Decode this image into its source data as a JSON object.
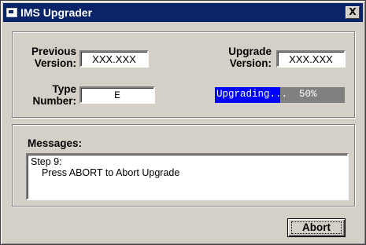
{
  "window": {
    "title": "IMS Upgrader",
    "close_label": "X"
  },
  "version_group": {
    "previous_version": {
      "label_line1": "Previous",
      "label_line2": "Version:",
      "value": "XXX.XXX"
    },
    "upgrade_version": {
      "label_line1": "Upgrade",
      "label_line2": "Version:",
      "value": "XXX.XXX"
    },
    "type_number": {
      "label_line1": "Type",
      "label_line2": "Number:",
      "value": "E"
    },
    "progress": {
      "text": "Upgrading...  50%",
      "percent": 50
    }
  },
  "messages_group": {
    "label": "Messages:",
    "lines": [
      "Step 9:",
      "Press ABORT to Abort Upgrade"
    ]
  },
  "buttons": {
    "abort_label": "Abort"
  },
  "colors": {
    "titlebar": "#0a246a",
    "face": "#d4d0c8",
    "progress_fill": "#0000ff",
    "progress_track": "#808080"
  }
}
